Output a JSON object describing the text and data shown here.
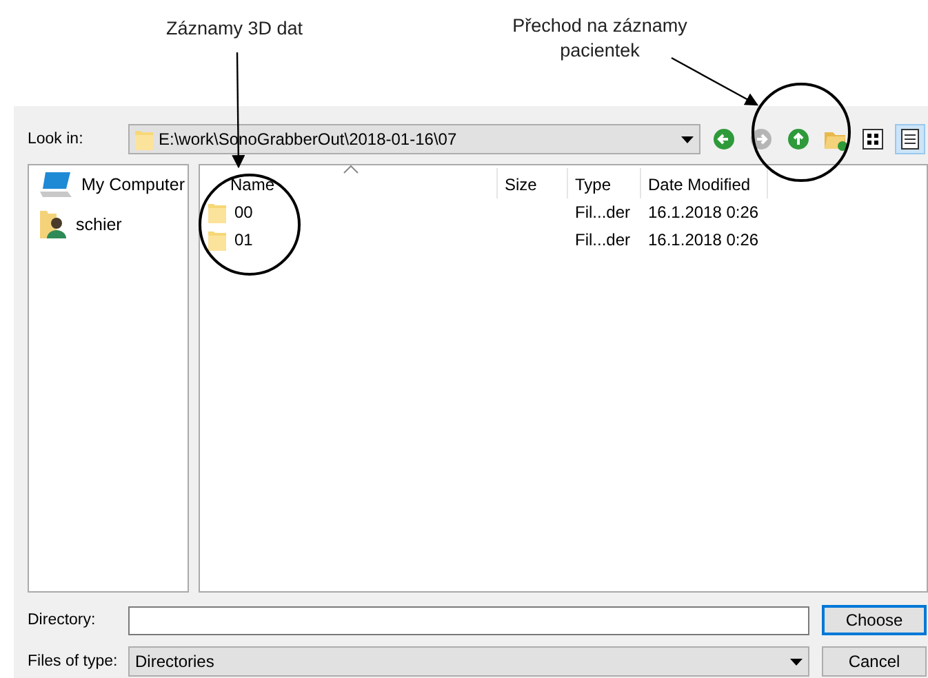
{
  "annotations": [
    {
      "text": "Záznamy 3D dat"
    },
    {
      "text": "Přechod na záznamy pacientek"
    }
  ],
  "dialog": {
    "look_in": {
      "label": "Look in:",
      "path": "E:\\work\\SonoGrabberOut\\2018-01-16\\07"
    },
    "toolbar": [
      {
        "kind": "back",
        "disabled": false
      },
      {
        "kind": "forward",
        "disabled": true
      },
      {
        "kind": "up",
        "disabled": false
      },
      {
        "kind": "new-folder",
        "disabled": false
      },
      {
        "kind": "list-view",
        "selected": false
      },
      {
        "kind": "details-view",
        "selected": true
      }
    ],
    "places": [
      {
        "kind": "computer",
        "label": "My Computer"
      },
      {
        "kind": "user",
        "label": "schier"
      }
    ],
    "columns": [
      "Name",
      "Size",
      "Type",
      "Date Modified"
    ],
    "rows": [
      {
        "name": "00",
        "type": "Fil...der",
        "date": "16.1.2018 0:26"
      },
      {
        "name": "01",
        "type": "Fil...der",
        "date": "16.1.2018 0:26"
      }
    ],
    "directory": {
      "label": "Directory:"
    },
    "files_of_type": {
      "label": "Files of type:",
      "value": "Directories"
    },
    "buttons": [
      {
        "label": "Choose",
        "default": true
      },
      {
        "label": "Cancel",
        "default": false
      }
    ]
  }
}
